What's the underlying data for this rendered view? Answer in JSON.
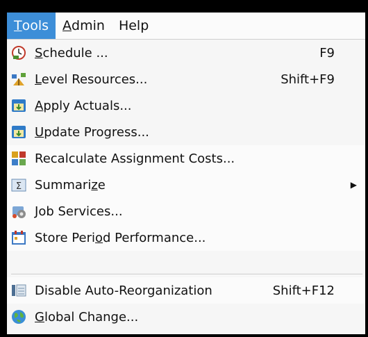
{
  "menubar": {
    "tools": {
      "pre": "",
      "u": "T",
      "post": "ools"
    },
    "admin": {
      "pre": "",
      "u": "A",
      "post": "dmin"
    },
    "help": {
      "label": "Help"
    }
  },
  "menu": {
    "schedule": {
      "pre": "",
      "u": "S",
      "post": "chedule ...",
      "shortcut": "F9",
      "icon": "clock-icon"
    },
    "level": {
      "pre": "",
      "u": "L",
      "post": "evel Resources...",
      "shortcut": "Shift+F9",
      "icon": "level-resources-icon"
    },
    "apply": {
      "pre": "",
      "u": "A",
      "post": "pply Actuals...",
      "icon": "apply-actuals-icon"
    },
    "update": {
      "pre": "",
      "u": "U",
      "post": "pdate Progress...",
      "icon": "update-progress-icon"
    },
    "recalc": {
      "label": "Recalculate Assignment Costs...",
      "icon": "recalculate-icon"
    },
    "summarize": {
      "pre": "Summari",
      "u": "z",
      "post": "e",
      "icon": "summarize-icon"
    },
    "job": {
      "pre": "",
      "u": "J",
      "post": "ob Services...",
      "icon": "job-services-icon"
    },
    "store": {
      "pre": "Store Peri",
      "u": "o",
      "post": "d Performance...",
      "icon": "store-period-icon"
    },
    "disable": {
      "label": "Disable Auto-Reorganization",
      "shortcut": "Shift+F12",
      "icon": "reorganization-icon"
    },
    "global": {
      "pre": "",
      "u": "G",
      "post": "lobal Change...",
      "icon": "globe-icon"
    }
  },
  "colors": {
    "highlight": "#3d8ed8",
    "menu_bg": "#f6f6f6"
  }
}
